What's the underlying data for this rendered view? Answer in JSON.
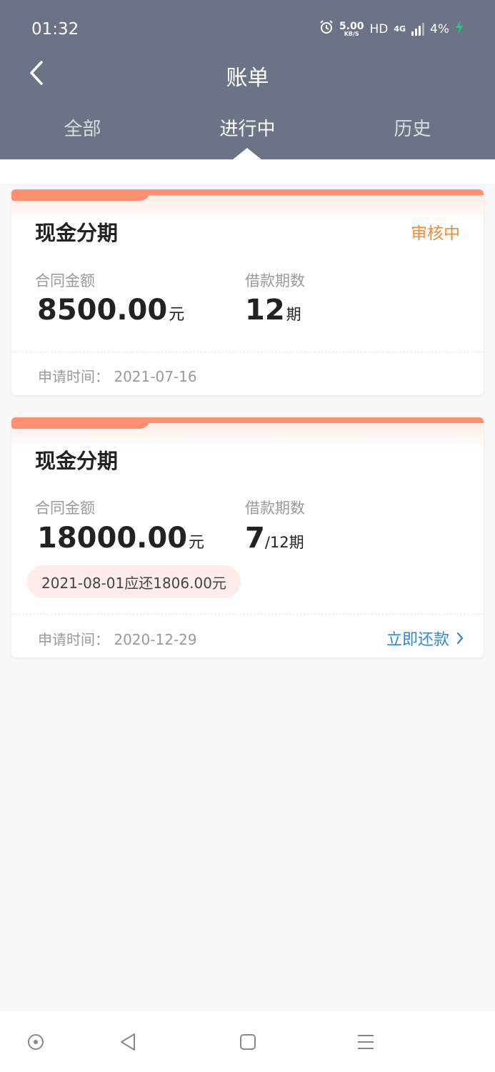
{
  "status_bar": {
    "time": "01:32",
    "net_speed": "5.00",
    "net_unit": "KB/S",
    "hd": "HD",
    "network": "4G",
    "battery": "4%"
  },
  "nav": {
    "title": "账单"
  },
  "tabs": [
    {
      "label": "全部"
    },
    {
      "label": "进行中"
    },
    {
      "label": "历史"
    }
  ],
  "cards": [
    {
      "title": "现金分期",
      "status": "审核中",
      "amount_label": "合同金额",
      "amount": "8500.00",
      "amount_unit": "元",
      "period_label": "借款期数",
      "period": "12",
      "period_unit": "期",
      "apply_time": "申请时间： 2021-07-16"
    },
    {
      "title": "现金分期",
      "amount_label": "合同金额",
      "amount": "18000.00",
      "amount_unit": "元",
      "period_label": "借款期数",
      "period": "7",
      "period_total": "/12期",
      "due_notice": "2021-08-01应还1806.00元",
      "apply_time": "申请时间： 2020-12-29",
      "action": "立即还款"
    }
  ],
  "colors": {
    "header_bg": "#6b7385",
    "accent_orange": "#ff8f73",
    "status_orange": "#f08c3a",
    "link_blue": "#2f86d6"
  }
}
